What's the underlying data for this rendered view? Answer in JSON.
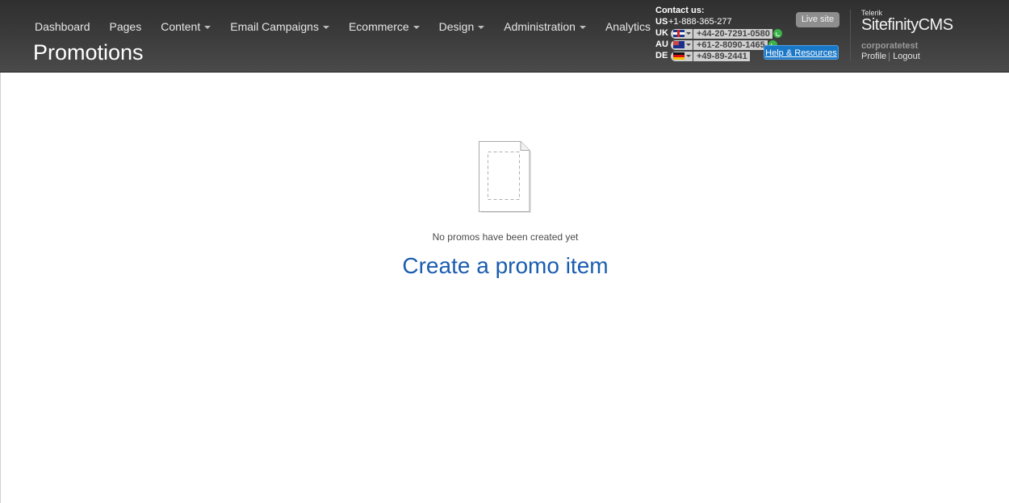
{
  "nav": {
    "items": [
      {
        "label": "Dashboard",
        "dropdown": false
      },
      {
        "label": "Pages",
        "dropdown": false
      },
      {
        "label": "Content",
        "dropdown": true
      },
      {
        "label": "Email Campaigns",
        "dropdown": true
      },
      {
        "label": "Ecommerce",
        "dropdown": true
      },
      {
        "label": "Design",
        "dropdown": true
      },
      {
        "label": "Administration",
        "dropdown": true
      },
      {
        "label": "Analytics",
        "dropdown": false
      }
    ]
  },
  "page": {
    "title": "Promotions"
  },
  "contact": {
    "title": "Contact us:",
    "rows": [
      {
        "code": "US",
        "number": "+1-888-365-277"
      },
      {
        "code": "UK",
        "number": "+44-20-7291-0580",
        "flag": "uk-flag-icon"
      },
      {
        "code": "AU",
        "number": "+61-2-8090-1465",
        "flag": "au-flag-icon"
      },
      {
        "code": "DE",
        "number": "+49-89-2441",
        "flag": "de-flag-icon"
      }
    ]
  },
  "header": {
    "live_site": "Live site",
    "help": "Help & Resources"
  },
  "brand": {
    "small": "Telerik",
    "name": "Sitefinity",
    "suffix": "CMS",
    "account": "corporatetest",
    "profile": "Profile",
    "logout": "Logout"
  },
  "empty_state": {
    "icon": "empty-document-icon",
    "message": "No promos have been created yet",
    "create": "Create a promo item"
  },
  "colors": {
    "header_bg": "#3a3a3a",
    "link": "#1a5cb0",
    "help_bg": "#1977c8",
    "live_site_bg": "#8e8e8e"
  }
}
